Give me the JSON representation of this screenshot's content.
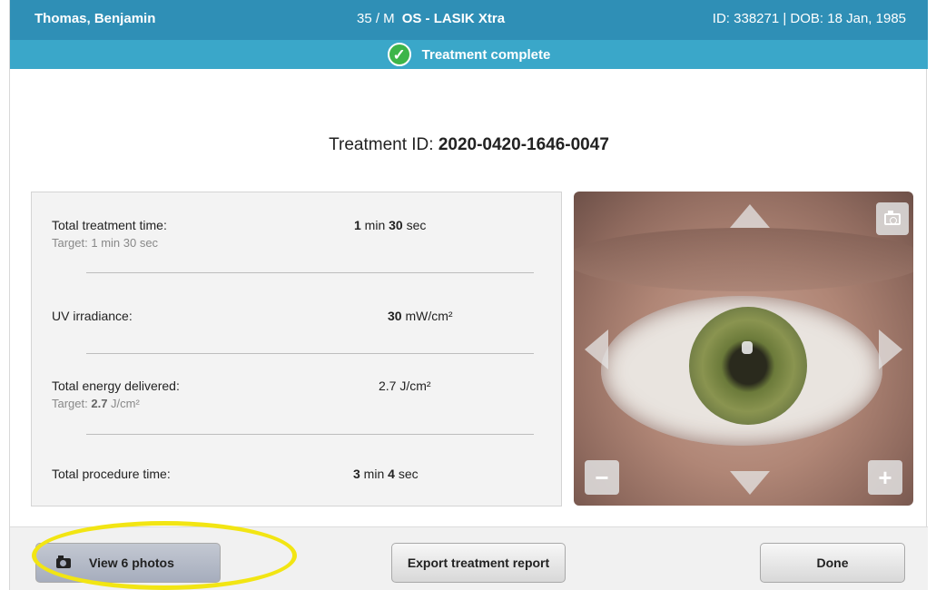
{
  "header": {
    "patient_name": "Thomas, Benjamin",
    "age_sex": "35 / M",
    "procedure": "OS - LASIK Xtra",
    "id_dob": "ID: 338271 | DOB: 18 Jan, 1985"
  },
  "status": {
    "text": "Treatment complete",
    "color": "#3db549"
  },
  "treatment": {
    "label": "Treatment ID: ",
    "id": "2020-0420-1646-0047"
  },
  "metrics": {
    "total_treatment_time": {
      "label": "Total treatment time:",
      "target_prefix": "Target: 1 min 30 sec",
      "value_min": "1",
      "value_min_unit": " min ",
      "value_sec": "30",
      "value_sec_unit": " sec"
    },
    "uv_irradiance": {
      "label": "UV irradiance:",
      "value": "30",
      "unit": " mW/cm²"
    },
    "total_energy": {
      "label": "Total energy delivered:",
      "target_label": "Target: ",
      "target_value": "2.7",
      "target_unit": " J/cm²",
      "value": "2.7  J/cm²"
    },
    "total_procedure_time": {
      "label": "Total procedure time:",
      "value_min": "3",
      "value_min_unit": " min ",
      "value_sec": "4",
      "value_sec_unit": " sec"
    }
  },
  "viewer": {
    "minus_label": "−",
    "plus_label": "+"
  },
  "footer": {
    "view_photos": "View 6 photos",
    "export": "Export treatment report",
    "done": "Done"
  },
  "colors": {
    "header_dark": "#2f8fb6",
    "header_light": "#3aa7c9",
    "highlight": "#f2e513"
  }
}
